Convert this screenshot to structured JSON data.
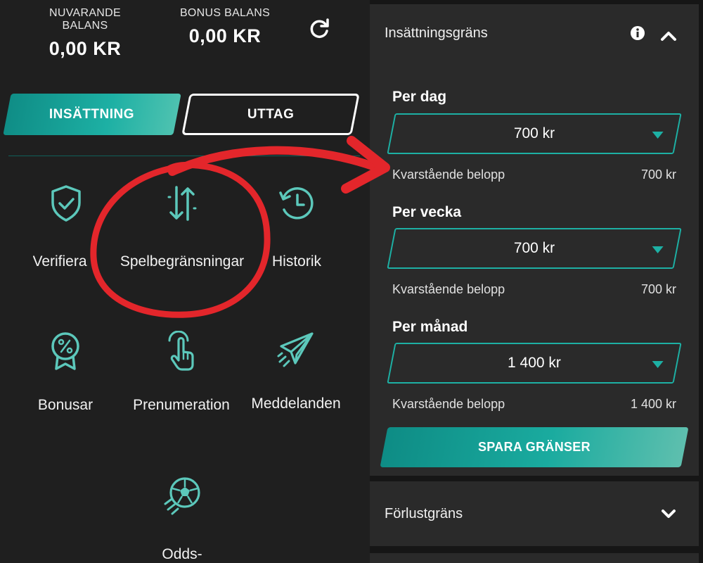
{
  "balances": {
    "current": {
      "label": "NUVARANDE BALANS",
      "value": "0,00 KR"
    },
    "bonus": {
      "label": "BONUS BALANS",
      "value": "0,00 KR"
    }
  },
  "tabs": {
    "deposit": "INSÄTTNING",
    "withdraw": "UTTAG"
  },
  "menu": {
    "verify": {
      "label": "Verifiera",
      "icon": "shield-check-icon"
    },
    "limits": {
      "label": "Spelbegränsningar",
      "icon": "up-down-arrows-icon"
    },
    "history": {
      "label": "Historik",
      "icon": "history-clock-icon"
    },
    "bonus": {
      "label": "Bonusar",
      "icon": "percent-badge-icon"
    },
    "subscription": {
      "label": "Prenumeration",
      "icon": "tap-hand-icon"
    },
    "messages": {
      "label": "Meddelanden",
      "icon": "paper-plane-icon"
    },
    "odds": {
      "label": "Odds-",
      "icon": "soccer-ball-icon"
    }
  },
  "deposit_limit": {
    "title": "Insättningsgräns",
    "periods": [
      {
        "label": "Per dag",
        "value": "700 kr",
        "remaining_label": "Kvarstående belopp",
        "remaining_value": "700 kr"
      },
      {
        "label": "Per vecka",
        "value": "700 kr",
        "remaining_label": "Kvarstående belopp",
        "remaining_value": "700 kr"
      },
      {
        "label": "Per månad",
        "value": "1 400 kr",
        "remaining_label": "Kvarstående belopp",
        "remaining_value": "1 400 kr"
      }
    ],
    "save_label": "SPARA GRÄNSER"
  },
  "loss_limit": {
    "title": "Förlustgräns"
  },
  "colors": {
    "accent": "#1db0a4",
    "background": "#1f1f1f",
    "card": "#2a2a2a",
    "annotation": "#e3262b"
  }
}
